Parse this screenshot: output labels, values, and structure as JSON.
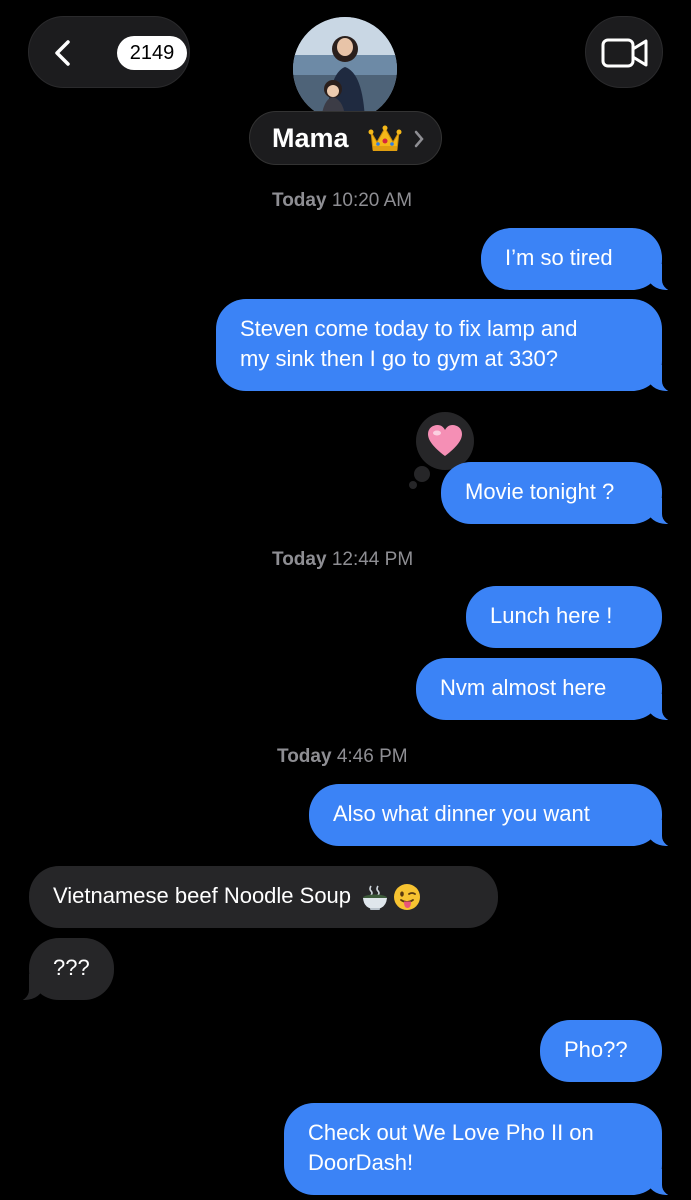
{
  "header": {
    "unread_count": "2149",
    "contact_name": "Mama"
  },
  "icons": {
    "back": "chevron-left-icon",
    "video": "video-camera-icon",
    "crown": "crown-emoji",
    "heart": "pink-heart-emoji",
    "pho": "steaming-bowl-emoji",
    "tongue": "face-with-tongue-emoji"
  },
  "colors": {
    "sent_bubble": "#3b83f6",
    "received_bubble": "#262628",
    "background": "#000000",
    "timestamp": "#8e8e93"
  },
  "timestamps": [
    {
      "day": "Today",
      "time": "10:20 AM"
    },
    {
      "day": "Today",
      "time": "12:44 PM"
    },
    {
      "day": "Today",
      "time": "4:46 PM"
    }
  ],
  "messages": [
    {
      "direction": "sent",
      "text": "I’m so tired"
    },
    {
      "direction": "sent",
      "text_line1": "Steven come today to fix lamp and",
      "text_line2": "my sink then I go to gym at 330?"
    },
    {
      "direction": "sent",
      "text": "Movie tonight ?",
      "tapback": "heart"
    },
    {
      "direction": "sent",
      "text": "Lunch here !"
    },
    {
      "direction": "sent",
      "text": "Nvm almost here"
    },
    {
      "direction": "sent",
      "text": "Also what dinner you want"
    },
    {
      "direction": "received",
      "text": "Vietnamese beef Noodle Soup"
    },
    {
      "direction": "received",
      "text": "???"
    },
    {
      "direction": "sent",
      "text": "Pho??"
    },
    {
      "direction": "sent",
      "text_line1": "Check out We Love Pho II on",
      "text_line2": "DoorDash!"
    }
  ]
}
